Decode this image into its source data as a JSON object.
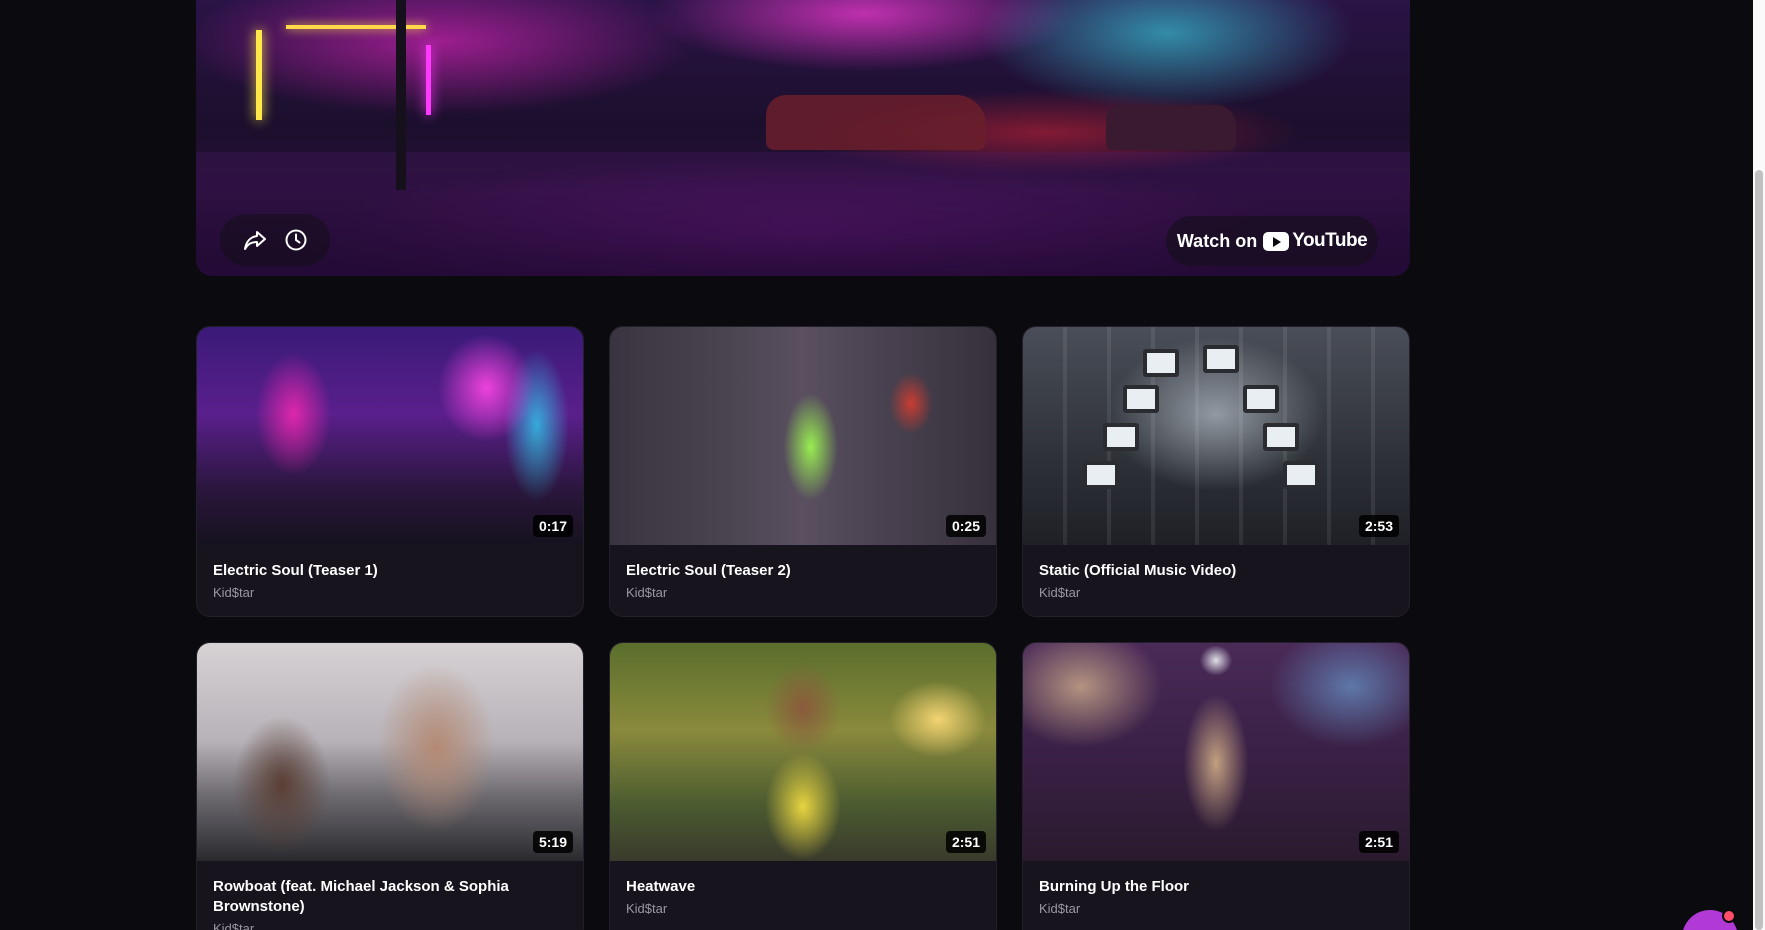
{
  "player": {
    "watch_on_label": "Watch on",
    "youtube_wordmark": "YouTube"
  },
  "videos": [
    {
      "title": "Electric Soul (Teaser 1)",
      "channel": "Kid$tar",
      "duration": "0:17"
    },
    {
      "title": "Electric Soul (Teaser 2)",
      "channel": "Kid$tar",
      "duration": "0:25"
    },
    {
      "title": "Static (Official Music Video)",
      "channel": "Kid$tar",
      "duration": "2:53"
    },
    {
      "title": "Rowboat (feat. Michael Jackson & Sophia Brownstone)",
      "channel": "Kid$tar",
      "duration": "5:19"
    },
    {
      "title": "Heatwave",
      "channel": "Kid$tar",
      "duration": "2:51"
    },
    {
      "title": "Burning Up the Floor",
      "channel": "Kid$tar",
      "duration": "2:51"
    }
  ],
  "icons": {
    "share": "share-icon",
    "watch_later": "clock-icon",
    "youtube": "youtube-logo-icon",
    "chat": "chat-icon"
  },
  "colors": {
    "background": "#0b0a0f",
    "card": "#17141d",
    "chat_accent": "#b13ad6"
  }
}
